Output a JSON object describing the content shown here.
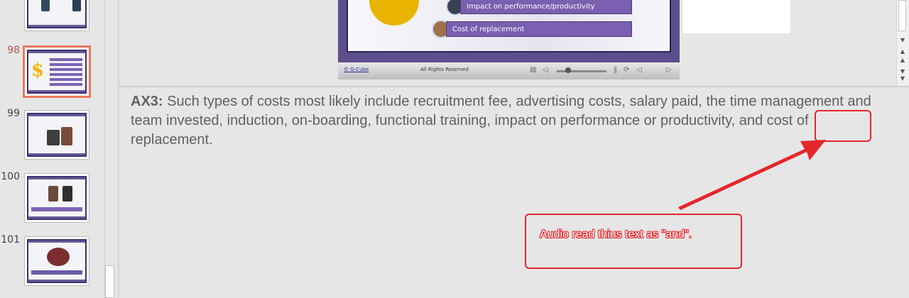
{
  "thumbnails": [
    {
      "number": "",
      "selected": false
    },
    {
      "number": "98",
      "selected": true
    },
    {
      "number": "99",
      "selected": false
    },
    {
      "number": "100",
      "selected": false
    },
    {
      "number": "101",
      "selected": false
    }
  ],
  "slide": {
    "items": [
      "Impact on performance/productivity",
      "Cost of replacement"
    ],
    "footer_link": "© G-Cube",
    "footer_rights": "All Rights Reserved"
  },
  "notes": {
    "label": "AX3:",
    "text": " Such types of costs most likely include recruitment fee, advertising costs, salary paid, the time management and team invested, induction, on-boarding, functional training, impact on performance or productivity, and cost of replacement."
  },
  "annotation": {
    "callout": "Audio read thius text as \"and\".",
    "color": "#e5262b"
  },
  "colors": {
    "selected_thumb_border": "#e8795d",
    "slide_purple": "#7b5fb0",
    "background": "#e6e6e6"
  },
  "icons": [
    "dollar-coin-icon",
    "scroll-up-icon",
    "scroll-down-icon",
    "player-play-icon",
    "player-pause-icon",
    "player-volume-icon"
  ]
}
